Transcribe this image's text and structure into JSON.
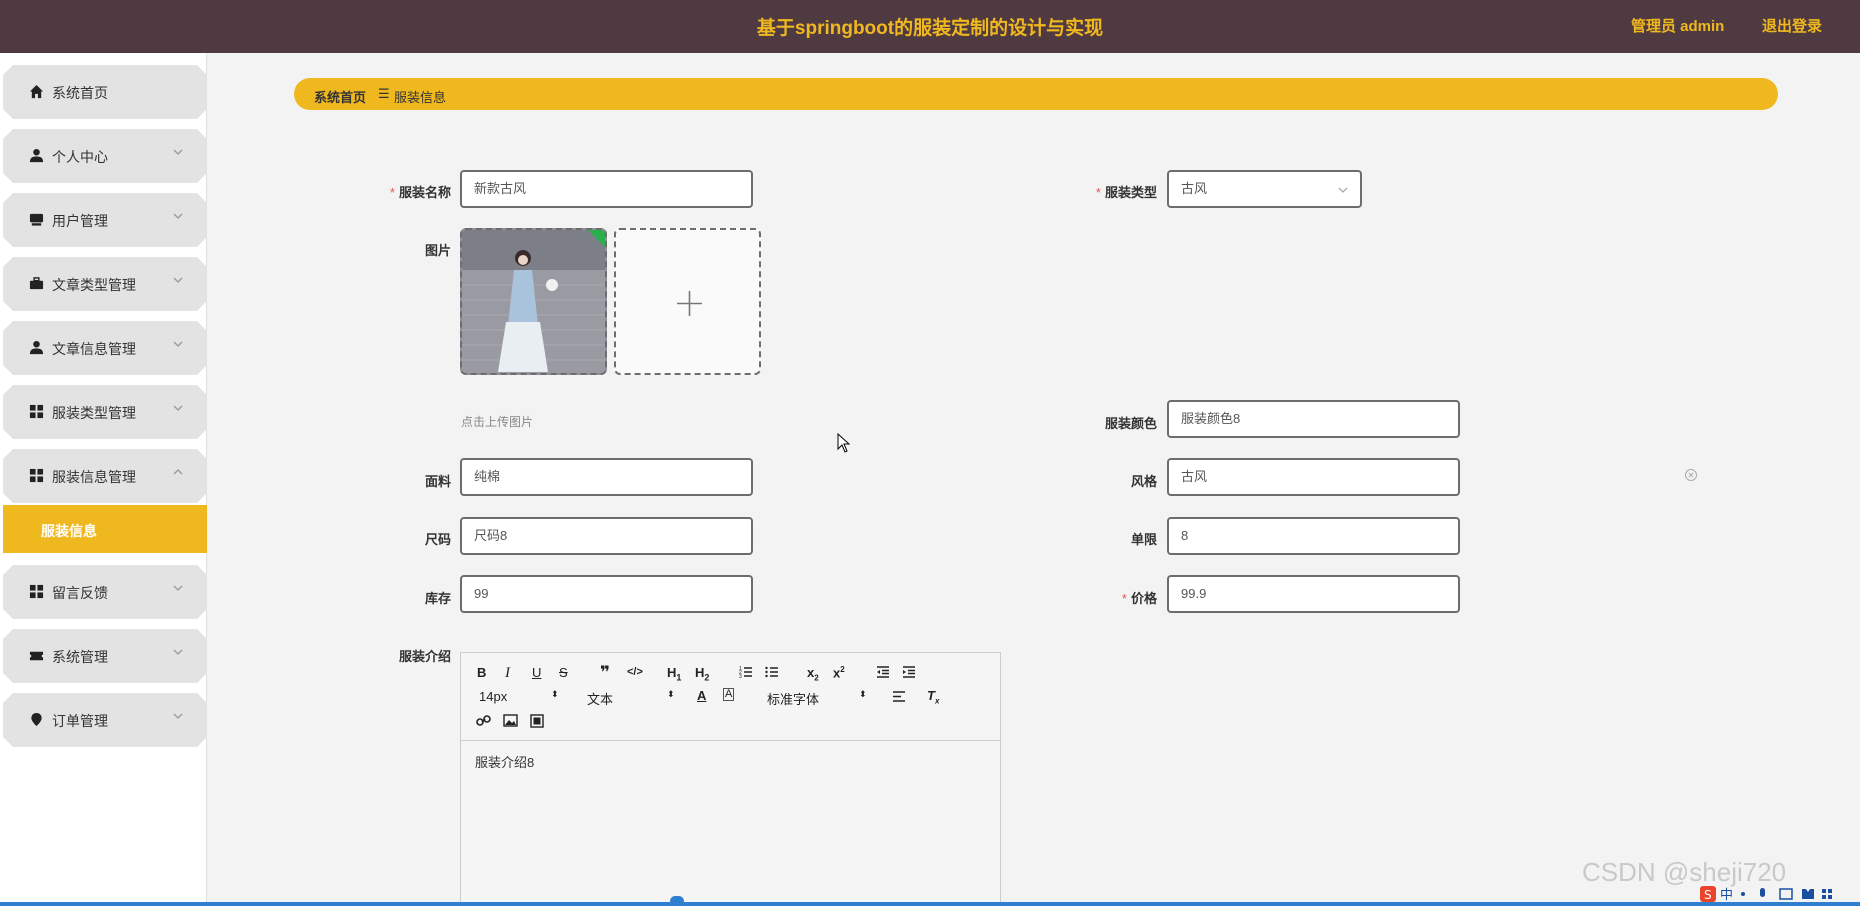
{
  "header": {
    "title": "基于springboot的服装定制的设计与实现",
    "admin_label": "管理员 admin",
    "logout_label": "退出登录"
  },
  "sidebar": {
    "items": [
      {
        "label": "系统首页",
        "icon": "home-icon"
      },
      {
        "label": "个人中心",
        "icon": "user-icon"
      },
      {
        "label": "用户管理",
        "icon": "folder-icon"
      },
      {
        "label": "文章类型管理",
        "icon": "briefcase-icon"
      },
      {
        "label": "文章信息管理",
        "icon": "user-icon"
      },
      {
        "label": "服装类型管理",
        "icon": "grid-icon"
      },
      {
        "label": "服装信息管理",
        "icon": "grid-icon"
      },
      {
        "label": "留言反馈",
        "icon": "grid-icon"
      },
      {
        "label": "系统管理",
        "icon": "ticket-icon"
      },
      {
        "label": "订单管理",
        "icon": "pin-icon"
      }
    ],
    "active_sub": "服装信息"
  },
  "breadcrumb": {
    "home": "系统首页",
    "separator": "☰",
    "current": "服装信息"
  },
  "form": {
    "name_label": "服装名称",
    "name_value": "新款古风",
    "type_label": "服装类型",
    "type_value": "古风",
    "image_label": "图片",
    "upload_tip": "点击上传图片",
    "color_label": "服装颜色",
    "color_value": "服装颜色8",
    "fabric_label": "面料",
    "fabric_value": "纯棉",
    "style_label": "风格",
    "style_value": "古风",
    "size_label": "尺码",
    "size_value": "尺码8",
    "limit_label": "单限",
    "limit_value": "8",
    "stock_label": "库存",
    "stock_value": "99",
    "price_label": "价格",
    "price_value": "99.9",
    "intro_label": "服装介绍",
    "intro_value": "服装介绍8"
  },
  "editor": {
    "font_size": "14px",
    "block_type": "文本",
    "font_family": "标准字体"
  },
  "watermark": "CSDN @sheji720",
  "colors": {
    "accent": "#f0b81f",
    "header_bg": "#4f3a41"
  }
}
